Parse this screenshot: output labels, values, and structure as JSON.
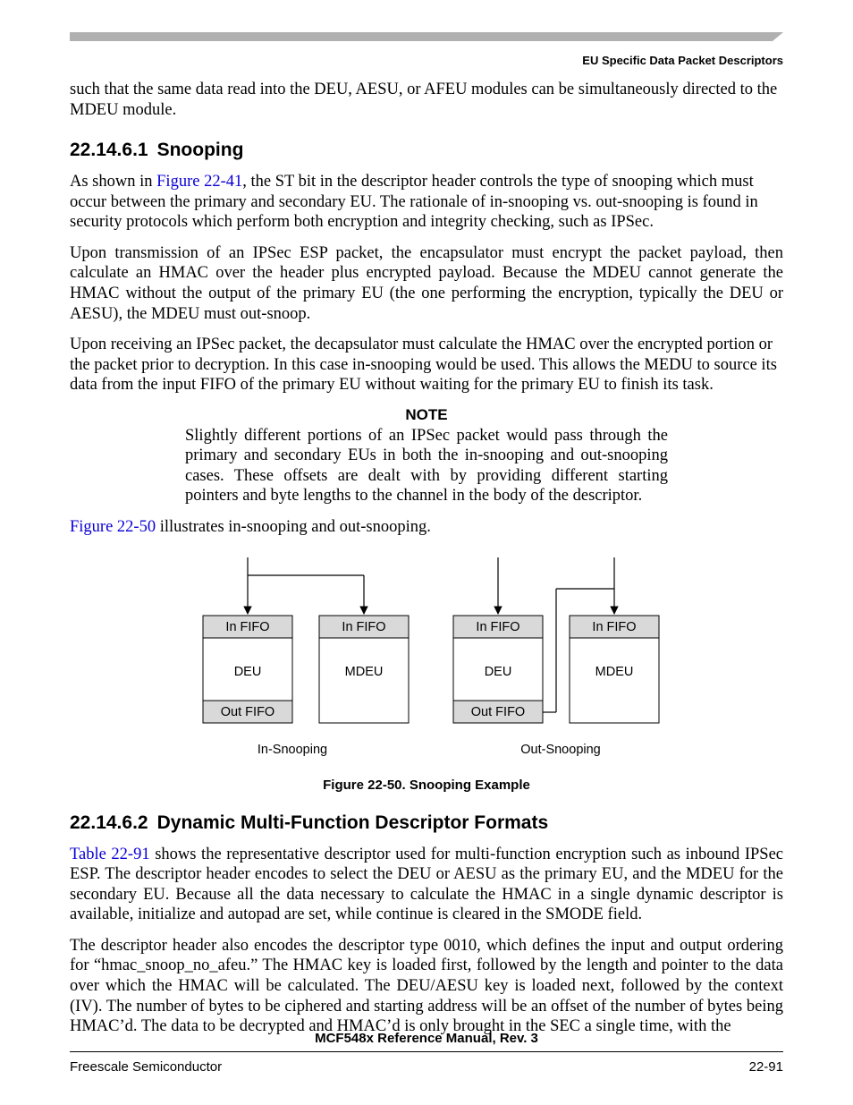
{
  "header": {
    "right": "EU Specific Data Packet Descriptors"
  },
  "intro": "such that the same data read into the DEU, AESU, or AFEU modules can be simultaneously directed to the MDEU module.",
  "sec1": {
    "num": "22.14.6.1",
    "title": "Snooping",
    "p1a": "As shown in ",
    "p1link": "Figure 22-41",
    "p1b": ", the ST bit in the descriptor header controls the type of snooping which must occur between the primary and secondary EU. The rationale of in-snooping vs. out-snooping is found in security protocols which perform both encryption and integrity checking, such as IPSec.",
    "p2": "Upon transmission of an IPSec ESP packet, the encapsulator must encrypt the packet payload, then calculate an HMAC over the header plus encrypted payload. Because the MDEU cannot generate the HMAC without the output of the primary EU (the one performing the encryption, typically the DEU or AESU), the MDEU must out-snoop.",
    "p3": "Upon receiving an IPSec packet, the decapsulator must calculate the HMAC over the encrypted portion or the packet prior to decryption. In this case in-snooping would be used. This allows the MEDU to source its data from the input FIFO of the primary EU without waiting for the primary EU to finish its task.",
    "noteLabel": "NOTE",
    "note": "Slightly different portions of an IPSec packet would pass through the primary and secondary EUs in both the in-snooping and out-snooping cases. These offsets are dealt with by providing different starting pointers and byte lengths to the channel in the body of the descriptor.",
    "p4link": "Figure 22-50",
    "p4b": " illustrates in-snooping and out-snooping."
  },
  "fig": {
    "caption": "Figure 22-50. Snooping Example",
    "inFifo": "In FIFO",
    "outFifo": "Out FIFO",
    "deu": "DEU",
    "mdeu": "MDEU",
    "inSnoop": "In-Snooping",
    "outSnoop": "Out-Snooping"
  },
  "sec2": {
    "num": "22.14.6.2",
    "title": "Dynamic Multi-Function Descriptor Formats",
    "p1link": "Table 22-91",
    "p1b": " shows the representative descriptor used for multi-function encryption such as inbound IPSec ESP. The descriptor header encodes to select the DEU or AESU as the primary EU, and the MDEU for the secondary EU. Because all the data necessary to calculate the HMAC in a single dynamic descriptor is available, initialize and autopad are set, while continue is cleared in the SMODE field.",
    "p2": "The descriptor header also encodes the descriptor type 0010, which defines the input and output ordering for “hmac_snoop_no_afeu.” The HMAC key is loaded first, followed by the length and pointer to the data over which the HMAC will be calculated. The DEU/AESU key is loaded next, followed by the context (IV). The number of bytes to be ciphered and starting address will be an offset of the number of bytes being HMAC’d. The data to be decrypted and HMAC’d is only brought in the SEC a single time, with the"
  },
  "footer": {
    "title": "MCF548x Reference Manual, Rev. 3",
    "left": "Freescale Semiconductor",
    "right": "22-91"
  }
}
